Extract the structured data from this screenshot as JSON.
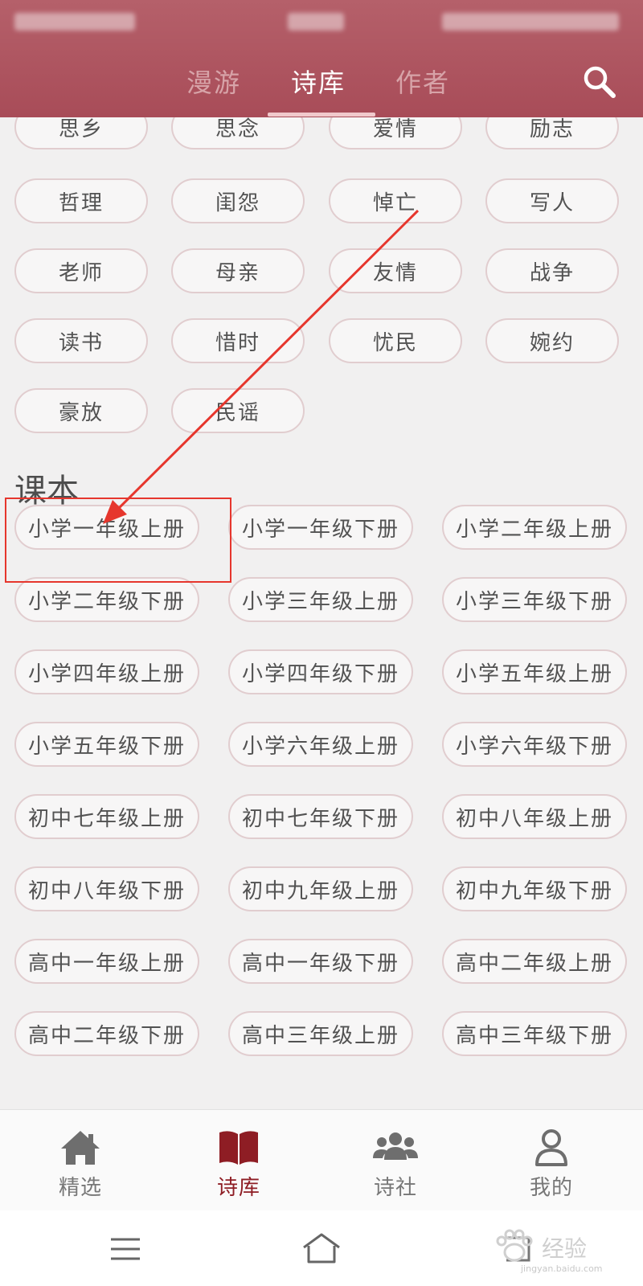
{
  "header": {
    "tabs": [
      {
        "label": "漫游",
        "active": false
      },
      {
        "label": "诗库",
        "active": true
      },
      {
        "label": "作者",
        "active": false
      }
    ],
    "search_icon": "search-icon"
  },
  "tags_partial": [
    "思乡",
    "思念",
    "爱情",
    "励志"
  ],
  "tags": [
    "哲理",
    "闺怨",
    "悼亡",
    "写人",
    "老师",
    "母亲",
    "友情",
    "战争",
    "读书",
    "惜时",
    "忧民",
    "婉约",
    "豪放",
    "民谣"
  ],
  "textbook": {
    "title": "课本",
    "items": [
      "小学一年级上册",
      "小学一年级下册",
      "小学二年级上册",
      "小学二年级下册",
      "小学三年级上册",
      "小学三年级下册",
      "小学四年级上册",
      "小学四年级下册",
      "小学五年级上册",
      "小学五年级下册",
      "小学六年级上册",
      "小学六年级下册",
      "初中七年级上册",
      "初中七年级下册",
      "初中八年级上册",
      "初中八年级下册",
      "初中九年级上册",
      "初中九年级下册",
      "高中一年级上册",
      "高中一年级下册",
      "高中二年级上册",
      "高中二年级下册",
      "高中三年级上册",
      "高中三年级下册"
    ]
  },
  "bottom_nav": [
    {
      "label": "精选",
      "icon": "home-icon",
      "active": false
    },
    {
      "label": "诗库",
      "icon": "book-icon",
      "active": true
    },
    {
      "label": "诗社",
      "icon": "group-icon",
      "active": false
    },
    {
      "label": "我的",
      "icon": "user-icon",
      "active": false
    }
  ],
  "watermark": {
    "text": "经验",
    "sub": "jingyan.baidu.com"
  },
  "colors": {
    "accent": "#a84c58",
    "active_nav": "#8e1d24",
    "annotation": "#e6362d"
  }
}
